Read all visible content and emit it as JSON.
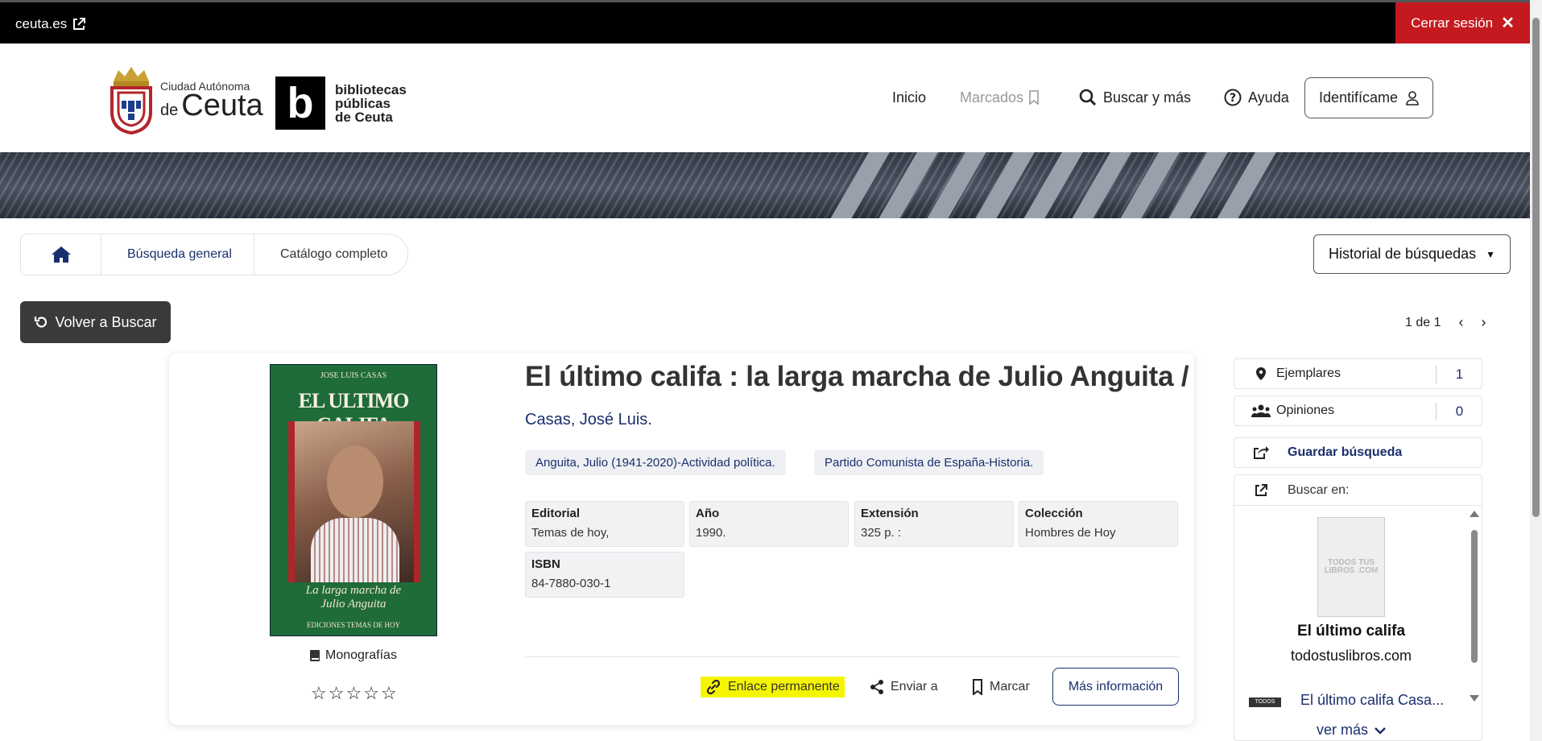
{
  "topbar": {
    "site": "ceuta.es",
    "logout": "Cerrar sesión"
  },
  "logo": {
    "ceuta_small": "Ciudad Autónoma",
    "ceuta_de": "de",
    "ceuta_big": "Ceuta",
    "bib_line1": "bibliotecas",
    "bib_line2": "públicas",
    "bib_line3": "de Ceuta"
  },
  "nav": {
    "inicio": "Inicio",
    "marcados": "Marcados",
    "buscar": "Buscar y más",
    "ayuda": "Ayuda",
    "identificame": "Identifícame"
  },
  "breadcrumb": {
    "item1": "Búsqueda general",
    "item2": "Catálogo completo"
  },
  "historial": "Historial de búsquedas",
  "volver": "Volver a Buscar",
  "pager": {
    "text": "1 de 1"
  },
  "cover": {
    "author": "JOSE LUIS CASAS",
    "title": "EL ULTIMO CALIFA",
    "subtitle1": "La larga marcha de",
    "subtitle2": "Julio Anguita",
    "publisher": "EDICIONES TEMAS DE HOY"
  },
  "record": {
    "type": "Monografías",
    "title": "El último califa : la larga marcha de Julio Anguita /",
    "author": "Casas, José Luis.",
    "subjects": [
      "Anguita, Julio (1941-2020)-Actividad política.",
      "Partido Comunista de España-Historia."
    ],
    "fields": [
      {
        "label": "Editorial",
        "value": "Temas de hoy,"
      },
      {
        "label": "Año",
        "value": "1990."
      },
      {
        "label": "Extensión",
        "value": "325 p. :"
      },
      {
        "label": "Colección",
        "value": "Hombres de Hoy"
      },
      {
        "label": "ISBN",
        "value": "84-7880-030-1"
      }
    ],
    "rating": 0
  },
  "actions": {
    "enlace": "Enlace permanente",
    "enviar": "Enviar a",
    "marcar": "Marcar",
    "mas": "Más información"
  },
  "sidebar": {
    "ejemplares_label": "Ejemplares",
    "ejemplares_count": "1",
    "opiniones_label": "Opiniones",
    "opiniones_count": "0",
    "guardar": "Guardar búsqueda",
    "buscar_en": "Buscar en:",
    "thumb_text": "TODOS TUS LIBROS .COM",
    "result_title": "El último califa",
    "result_site": "todostuslibros.com",
    "result2_logo": "TODOS",
    "result2_title": "El último califa Casa...",
    "ver_mas": "ver más"
  },
  "colors": {
    "accent": "#1a2f6d",
    "logout": "#c41a1f",
    "highlight": "#f5f500"
  }
}
